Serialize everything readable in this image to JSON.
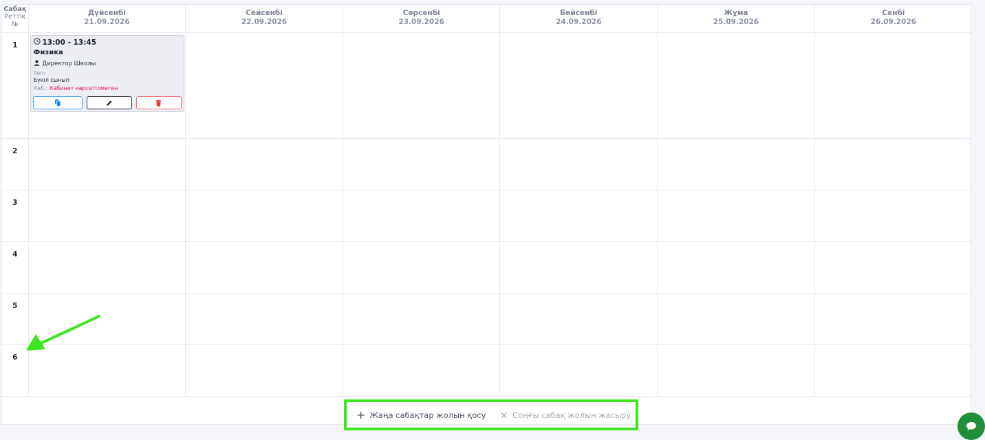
{
  "header": {
    "num_col": {
      "line1": "Сабақ",
      "line2": "Реттік",
      "line3": "№"
    },
    "days": [
      {
        "name": "Дүйсенбі",
        "date": "21.09.2026"
      },
      {
        "name": "Сейсенбі",
        "date": "22.09.2026"
      },
      {
        "name": "Сәрсенбі",
        "date": "23.09.2026"
      },
      {
        "name": "Бейсенбі",
        "date": "24.09.2026"
      },
      {
        "name": "Жұма",
        "date": "25.09.2026"
      },
      {
        "name": "Сенбі",
        "date": "26.09.2026"
      }
    ]
  },
  "rows": [
    "1",
    "2",
    "3",
    "4",
    "5",
    "6"
  ],
  "lesson": {
    "time": "13:00 - 13:45",
    "subject": "Физика",
    "teacher": "Директор Школы",
    "group_label": "Топ:",
    "group_value": "Бүкіл сынып",
    "room_label": "Каб.:",
    "room_value": "Кабинет көрсетілмеген",
    "icons": [
      "clock-icon",
      "user-icon",
      "copy-icon",
      "pencil-icon",
      "trash-icon"
    ],
    "colors": {
      "copy": "#4aa3f0",
      "delete": "#ef6b6b",
      "warning": "#d81b60"
    }
  },
  "footer": {
    "add_label": "Жаңа сабақтар жолын қосу",
    "hide_label": "Соңғы сабақ жолын жасыру"
  },
  "annotation": {
    "highlight_color": "#3ee51e"
  },
  "chat": {
    "icon": "chat-icon",
    "color": "#1f8f3a"
  }
}
